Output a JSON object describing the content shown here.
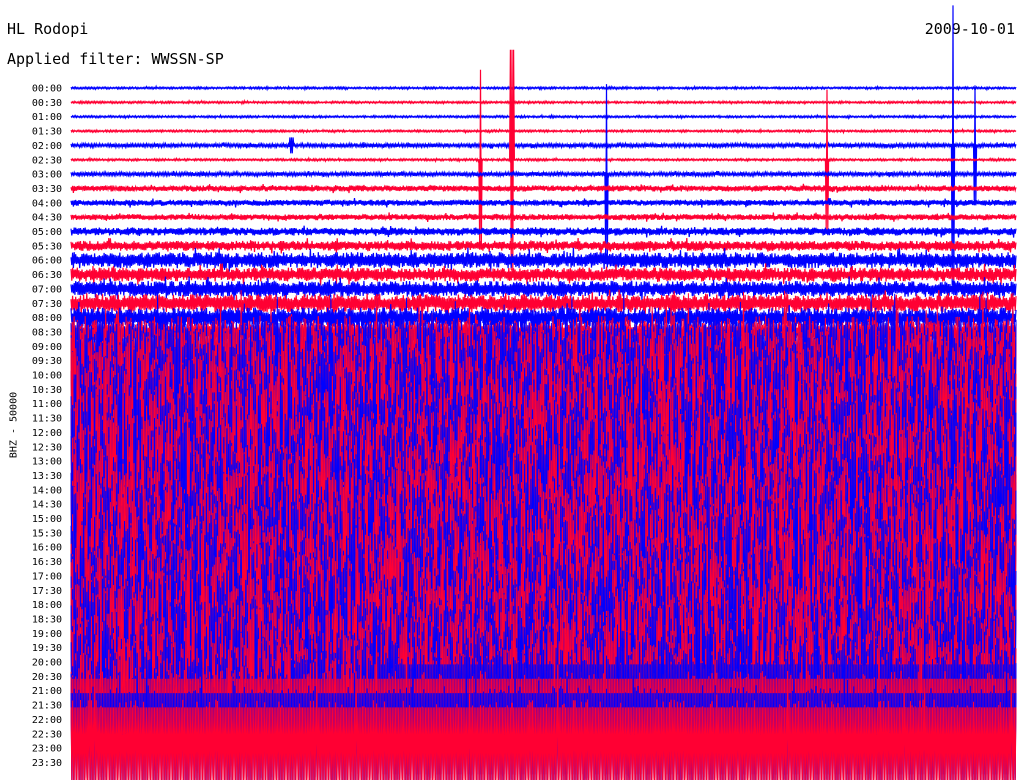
{
  "header": {
    "station": "HL Rodopi",
    "date": "2009-10-01",
    "filter": "Applied filter: WWSSN-SP"
  },
  "colors": {
    "blue": "#0000ff",
    "red": "#ff0033"
  },
  "chart_data": {
    "type": "line",
    "title": "HL Rodopi",
    "subtitle": "Applied filter: WWSSN-SP",
    "ylabel": "BHZ - 50000",
    "xlabel": "",
    "grid": false,
    "rows": [
      "00:00",
      "00:30",
      "01:00",
      "01:30",
      "02:00",
      "02:30",
      "03:00",
      "03:30",
      "04:00",
      "04:30",
      "05:00",
      "05:30",
      "06:00",
      "06:30",
      "07:00",
      "07:30",
      "08:00",
      "08:30",
      "09:00",
      "09:30",
      "10:00",
      "10:30",
      "11:00",
      "11:30",
      "12:00",
      "12:30",
      "13:00",
      "13:30",
      "14:00",
      "14:30",
      "15:00",
      "15:30",
      "16:00",
      "16:30",
      "17:00",
      "17:30",
      "18:00",
      "18:30",
      "19:00",
      "19:30",
      "20:00",
      "20:30",
      "21:00",
      "21:30",
      "22:00",
      "22:30",
      "23:00",
      "23:30"
    ],
    "row_colors": [
      "blue",
      "red"
    ],
    "noise_amplitude": [
      1,
      1,
      1,
      1,
      2,
      1,
      2,
      3,
      3,
      3,
      4,
      5,
      8,
      7,
      8,
      9,
      10,
      12,
      35,
      45,
      55,
      58,
      60,
      62,
      62,
      63,
      63,
      63,
      63,
      63,
      63,
      63,
      63,
      63,
      63,
      63,
      63,
      63,
      63,
      63,
      63,
      63,
      63,
      63,
      63,
      63,
      63,
      63
    ],
    "spikes": [
      {
        "row": 4,
        "minute": 7,
        "amplitude": 8
      },
      {
        "row": 5,
        "minute": 13,
        "amplitude": 90
      },
      {
        "row": 5,
        "minute": 14,
        "amplitude": 110
      },
      {
        "row": 6,
        "minute": 17,
        "amplitude": 90
      },
      {
        "row": 5,
        "minute": 24,
        "amplitude": 70
      },
      {
        "row": 4,
        "minute": 28,
        "amplitude": 140
      },
      {
        "row": 4,
        "minute": 28.7,
        "amplitude": 60
      }
    ],
    "saturated_from": {
      "row": 44,
      "minute": 9.7
    }
  }
}
